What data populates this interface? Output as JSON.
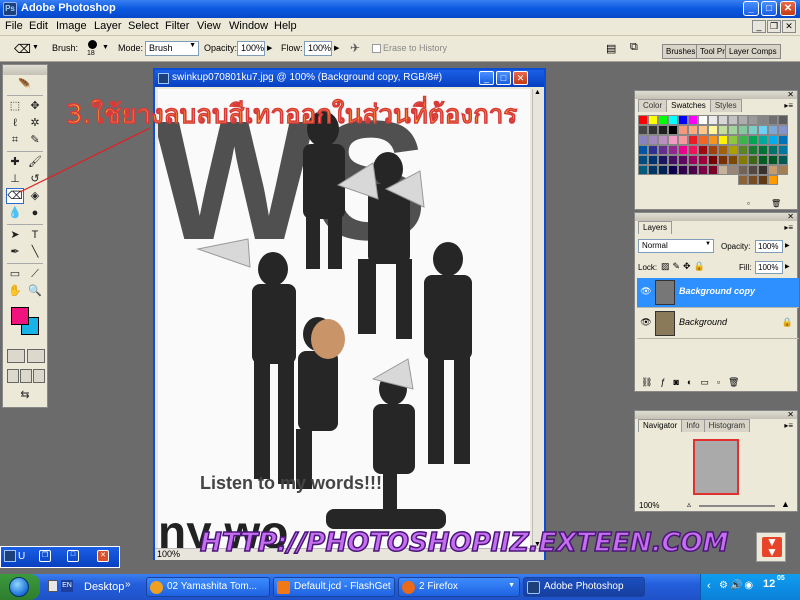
{
  "window": {
    "title": "Adobe Photoshop"
  },
  "menu": [
    "File",
    "Edit",
    "Image",
    "Layer",
    "Select",
    "Filter",
    "View",
    "Window",
    "Help"
  ],
  "options": {
    "brush_label": "Brush:",
    "brush_size": "18",
    "mode_label": "Mode:",
    "mode_value": "Brush",
    "opacity_label": "Opacity:",
    "opacity_value": "100%",
    "flow_label": "Flow:",
    "flow_value": "100%",
    "erase_history_label": "Erase to History",
    "well_tabs": [
      "Brushes",
      "Tool Pr",
      "Layer Comps"
    ]
  },
  "document": {
    "title": "swinkup070801ku7.jpg @ 100% (Background copy, RGB/8#)",
    "zoom": "100%",
    "canvas_text": {
      "big": "WS",
      "tagline": "Listen to my words!!!",
      "bottom": "ny wo"
    }
  },
  "annotation": "3.ใช้ยางลบลบสีเทาออกในส่วนที่ต้องการ",
  "watermark": "HTTP://PHOTOSHOPIIZ.EXTEEN.COM",
  "swatches_panel": {
    "tabs": [
      "Color",
      "Swatches",
      "Styles"
    ],
    "active_tab": "Swatches"
  },
  "layers_panel": {
    "tab": "Layers",
    "blend_mode": "Normal",
    "opacity_label": "Opacity:",
    "opacity_value": "100%",
    "lock_label": "Lock:",
    "fill_label": "Fill:",
    "fill_value": "100%",
    "layers": [
      {
        "name": "Background copy",
        "selected": true
      },
      {
        "name": "Background",
        "selected": false
      }
    ]
  },
  "navigator_panel": {
    "tabs": [
      "Navigator",
      "Info",
      "Histogram"
    ],
    "active_tab": "Navigator",
    "zoom": "100%"
  },
  "taskbar": {
    "desktop_label": "Desktop",
    "lang": "EN",
    "buttons": [
      {
        "label": "02 Yamashita Tom...",
        "color": "#f0a020"
      },
      {
        "label": "Default.jcd - FlashGet",
        "color": "#f07818"
      },
      {
        "label": "2 Firefox",
        "color": "#e86a1a"
      },
      {
        "label": "Adobe Photoshop",
        "color": "#1d3f7a"
      }
    ],
    "clock": "12",
    "clock_min": "05"
  },
  "minimized_doc": "U"
}
